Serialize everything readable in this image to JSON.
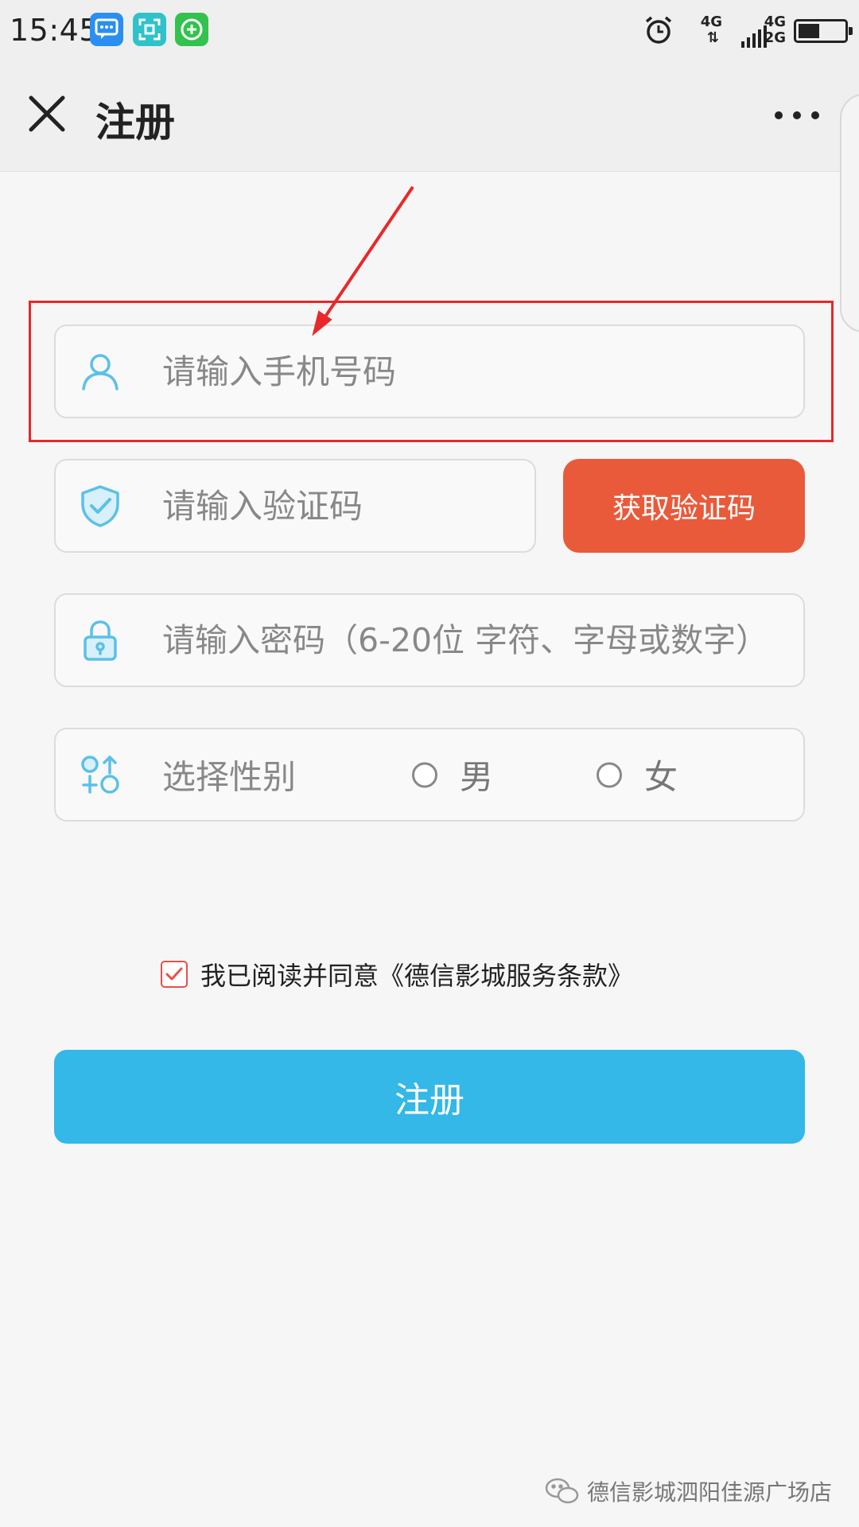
{
  "status_bar": {
    "time": "15:45",
    "network_top_left": "4G",
    "network_top_right": "4G",
    "network_bottom_right": "2G",
    "battery_level": 0.4
  },
  "header": {
    "title": "注册"
  },
  "form": {
    "phone_placeholder": "请输入手机号码",
    "code_placeholder": "请输入验证码",
    "get_code_label": "获取验证码",
    "password_placeholder": "请输入密码（6-20位 字符、字母或数字）",
    "gender_label": "选择性别",
    "gender_options": [
      "男",
      "女"
    ]
  },
  "agreement": {
    "text": "我已阅读并同意《德信影城服务条款》",
    "checked": true
  },
  "register_label": "注册",
  "watermark": "德信影城泗阳佳源广场店",
  "colors": {
    "accent_orange": "#e95a3a",
    "accent_blue": "#33b8e7",
    "annotation_red": "#e8282a",
    "icon_blue": "#5bc0e8"
  },
  "icons": [
    "message-icon",
    "scan-icon",
    "plus-icon",
    "alarm-icon",
    "signal-icon",
    "battery-icon",
    "close-icon",
    "more-icon",
    "user-icon",
    "shield-check-icon",
    "lock-icon",
    "gender-icon",
    "checkmark-icon",
    "wechat-icon"
  ]
}
